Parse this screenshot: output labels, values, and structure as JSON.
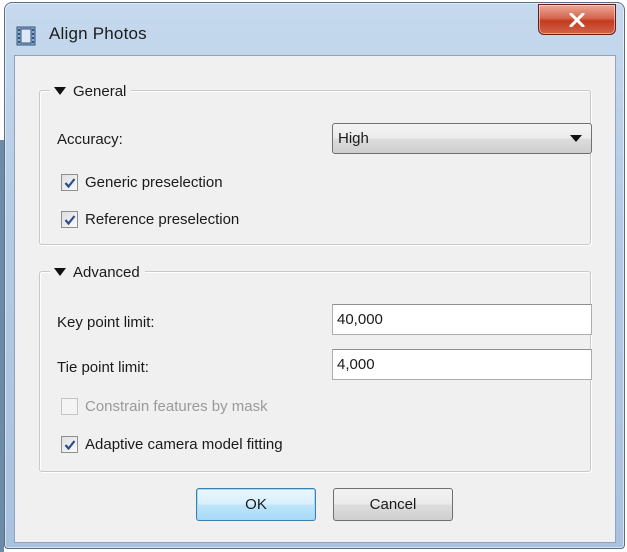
{
  "window": {
    "title": "Align Photos",
    "close_symbol": "x"
  },
  "general": {
    "legend": "General",
    "accuracy_label": "Accuracy:",
    "accuracy_value": "High",
    "generic_preselection": {
      "label": "Generic preselection",
      "checked": true
    },
    "reference_preselection": {
      "label": "Reference preselection",
      "checked": true
    }
  },
  "advanced": {
    "legend": "Advanced",
    "key_point_label": "Key point limit:",
    "key_point_value": "40,000",
    "tie_point_label": "Tie point limit:",
    "tie_point_value": "4,000",
    "constrain_mask": {
      "label": "Constrain features by mask",
      "checked": false,
      "enabled": false
    },
    "adaptive_fitting": {
      "label": "Adaptive camera model fitting",
      "checked": true
    }
  },
  "buttons": {
    "ok": "OK",
    "cancel": "Cancel"
  },
  "icons": {
    "app": "film-strip-icon",
    "close": "close-icon",
    "expand": "triangle-down-icon",
    "dropdown": "chevron-down-icon",
    "check": "checkmark-icon"
  },
  "colors": {
    "titlebar": "#b4cbe5",
    "close_button": "#c23b1f",
    "dialog_bg": "#f0f0f0",
    "default_button": "#bee6fd",
    "checkmark": "#2a4e8c"
  }
}
